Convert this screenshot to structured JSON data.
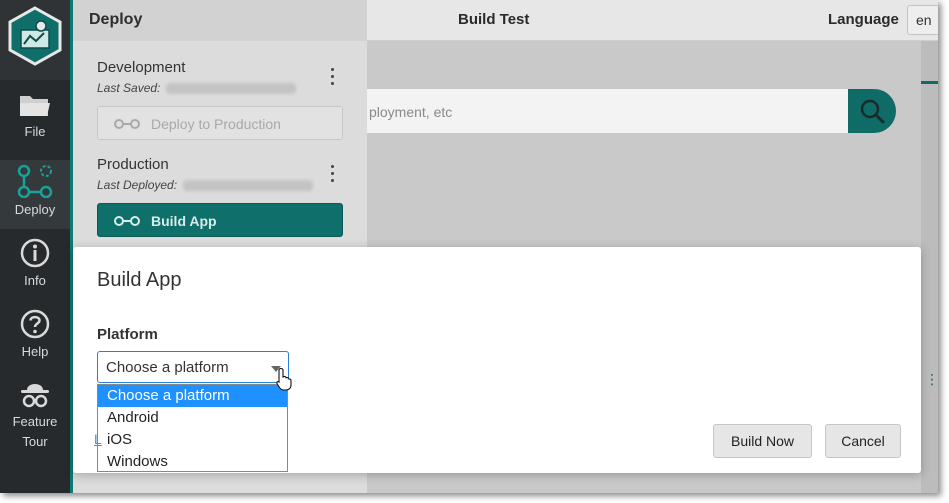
{
  "topbar": {
    "title": "Build Test",
    "language_label": "Language",
    "language_value": "en"
  },
  "rail": {
    "items": [
      {
        "label": "File",
        "icon": "folder-icon"
      },
      {
        "label": "Deploy",
        "icon": "deploy-icon",
        "active": true
      },
      {
        "label": "Info",
        "icon": "info-icon"
      },
      {
        "label": "Help",
        "icon": "help-icon"
      },
      {
        "label": "Feature\nTour",
        "icon": "spy-icon"
      }
    ]
  },
  "deploy_panel": {
    "header": "Deploy",
    "development": {
      "title": "Development",
      "sub_label": "Last Saved:",
      "button": "Deploy to Production"
    },
    "production": {
      "title": "Production",
      "sub_label": "Last Deployed:",
      "button": "Build App"
    }
  },
  "search": {
    "placeholder": "ployment, etc"
  },
  "modal": {
    "title": "Build App",
    "platform_label": "Platform",
    "selected": "Choose a platform",
    "options": [
      "Choose a platform",
      "Android",
      "iOS",
      "Windows"
    ],
    "link_fragment": "L",
    "build_button": "Build Now",
    "cancel_button": "Cancel"
  },
  "colors": {
    "accent": "#0e6b66",
    "rail": "#262a2c",
    "select_highlight": "#1e90ff"
  }
}
